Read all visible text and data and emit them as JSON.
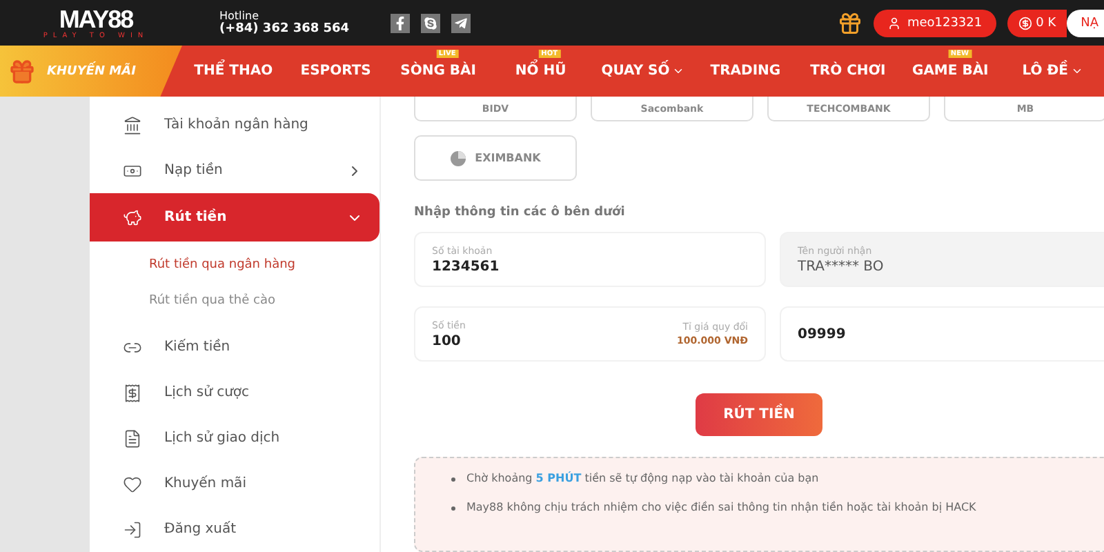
{
  "header": {
    "logo": {
      "name": "MAY88",
      "tagline": "PLAY TO WIN"
    },
    "hotline": {
      "label": "Hotline",
      "number": "(+84) 362 368 564"
    },
    "user": "meo123321",
    "balance": "0 K",
    "deposit": "NẠ"
  },
  "nav": {
    "promo": "KHUYẾN MÃI",
    "items": [
      {
        "label": "THỂ THAO",
        "dropdown": false
      },
      {
        "label": "ESPORTS",
        "dropdown": false
      },
      {
        "label": "SÒNG BÀI",
        "badge": "LIVE",
        "dropdown": false
      },
      {
        "label": "NỔ HŨ",
        "badge": "HOT",
        "dropdown": false
      },
      {
        "label": "QUAY SỐ",
        "dropdown": true
      },
      {
        "label": "TRADING",
        "dropdown": false
      },
      {
        "label": "TRÒ CHƠI",
        "dropdown": false
      },
      {
        "label": "GAME BÀI",
        "badge": "NEW",
        "dropdown": false
      },
      {
        "label": "LÔ ĐỀ",
        "dropdown": true
      }
    ]
  },
  "sidebar": {
    "items": [
      {
        "label": "Tài khoản ngân hàng",
        "selected": false
      },
      {
        "label": "Nạp tiền",
        "selected": false,
        "expanded": false
      },
      {
        "label": "Rút tiền",
        "selected": true,
        "expanded": true,
        "children": [
          {
            "label": "Rút tiền qua ngân hàng",
            "selected": true
          },
          {
            "label": "Rút tiền qua thẻ cào",
            "selected": false
          }
        ]
      },
      {
        "label": "Kiếm tiền",
        "selected": false
      },
      {
        "label": "Lịch sử cược",
        "selected": false
      },
      {
        "label": "Lịch sử giao dịch",
        "selected": false
      },
      {
        "label": "Khuyến mãi",
        "selected": false
      },
      {
        "label": "Đăng xuất",
        "selected": false
      }
    ]
  },
  "banks": [
    {
      "label": "BIDV"
    },
    {
      "label": "Sacombank"
    },
    {
      "label": "TECHCOMBANK"
    },
    {
      "label": "MB"
    },
    {
      "label": "EXIMBANK"
    }
  ],
  "form": {
    "instruction": "Nhập thông tin các ô bên dưới",
    "fields": [
      {
        "label": "Số tài khoản",
        "value": "1234561",
        "disabled": false
      },
      {
        "label": "Tên người nhận",
        "value": "TRA***** BO",
        "disabled": true
      },
      {
        "label": "Số tiền",
        "value": "100",
        "disabled": false,
        "rate_label": "Tỉ giá quy đổi",
        "rate_value": "100.000 VNĐ"
      },
      {
        "value": "09999",
        "disabled": false
      }
    ],
    "submit": "RÚT TIỀN"
  },
  "notes": [
    "Chờ khoảng **5 PHÚT** tiền sẽ tự động nạp vào tài khoản của bạn",
    "May88 không chịu trách nhiệm cho việc điền sai thông tin nhận tiền hoặc tài khoản bị HACK"
  ]
}
